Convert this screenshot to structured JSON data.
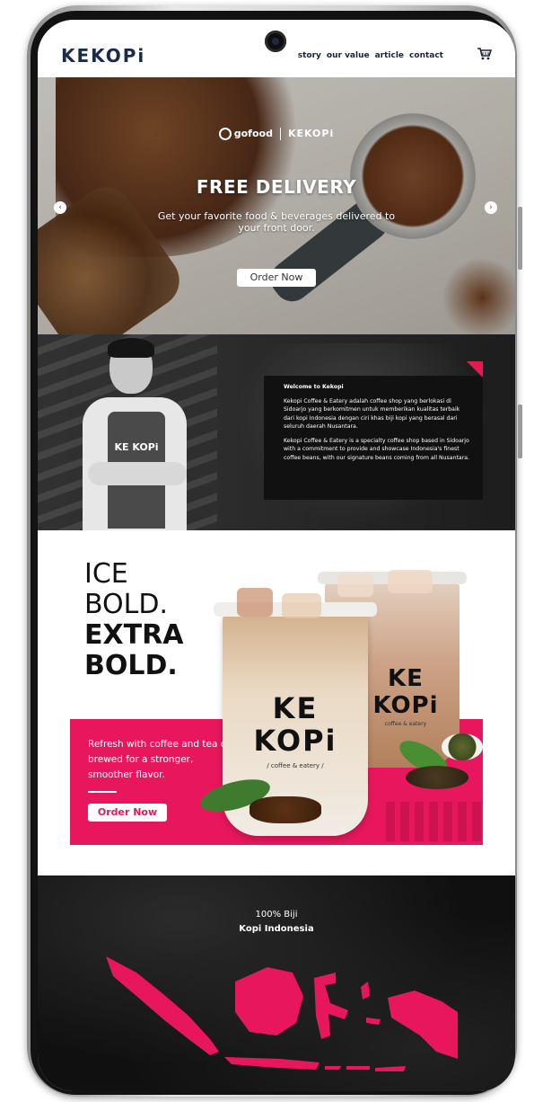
{
  "header": {
    "logo": "KEKOPi",
    "nav": [
      "story",
      "our value",
      "article",
      "contact"
    ],
    "cart_icon": "cart-icon"
  },
  "hero": {
    "partner_left": "gofood",
    "partner_right": "KEKOPi",
    "title": "FREE DELIVERY",
    "subtitle": "Get your favorite food & beverages delivered to your front door.",
    "order_button": "Order Now",
    "prev_icon": "chevron-left-icon",
    "next_icon": "chevron-right-icon"
  },
  "welcome": {
    "heading": "Welcome to Kekopi",
    "paragraph1": "Kekopi Coffee & Eatery adalah coffee shop yang berlokasi di Sidoarjo yang berkomitmen untuk memberikan kualitas terbaik dari kopi Indonesia dengan ciri khas biji kopi yang berasal dari seluruh daerah Nusantara.",
    "paragraph2": "Kekopi Coffee & Eatery is a specialty coffee shop based in Sidoarjo with a commitment to provide and showcase Indonesia's finest coffee beans, with our signature beans coming from all Nusantara.",
    "apron_text": "KE KOPi"
  },
  "ice": {
    "line1": "ICE",
    "line2": "BOLD.",
    "line3": "EXTRA",
    "line4": "BOLD.",
    "description": "Refresh with coffee and tea cold brewed for a stronger, smoother flavor.",
    "order_button": "Order Now",
    "cup_front_logo": "KE KOPi",
    "cup_front_sub": "/ coffee & eatery /",
    "cup_back_logo": "KE KOPi",
    "cup_back_sub": "coffee & eatery"
  },
  "map": {
    "line1": "100% Biji",
    "line2": "Kopi Indonesia"
  },
  "colors": {
    "accent_pink": "#e8175d",
    "logo_navy": "#1c2a4a",
    "dark_section": "#111111"
  }
}
